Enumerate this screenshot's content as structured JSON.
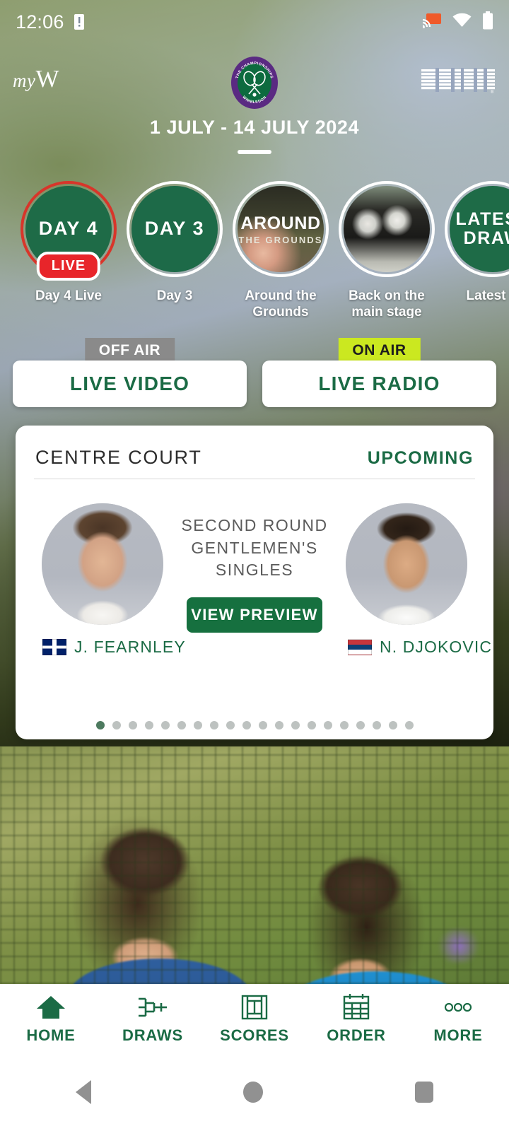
{
  "status_bar": {
    "time": "12:06",
    "icons": [
      "alarm-icon",
      "cast-icon",
      "wifi-icon",
      "battery-icon"
    ]
  },
  "header": {
    "my_wimbledon_label": "myW",
    "my_prefix": "my",
    "w_suffix": "W",
    "crest_label": "THE CHAMPIONSHIPS WIMBLEDON",
    "sponsor": "IBM",
    "dates": "1 JULY - 14 JULY 2024"
  },
  "stories": [
    {
      "ring_text": "DAY 4",
      "label": "Day 4 Live",
      "live": true,
      "live_badge": "LIVE",
      "style": "green"
    },
    {
      "ring_text": "DAY 3",
      "label": "Day 3",
      "live": false,
      "style": "green"
    },
    {
      "ring_text": "AROUND",
      "ring_sub": "THE GROUNDS",
      "label": "Around the Grounds",
      "live": false,
      "style": "photo-grounds"
    },
    {
      "ring_text": "",
      "label": "Back on the main stage",
      "live": false,
      "style": "photo-stage"
    },
    {
      "ring_text": "LATEST DRAW",
      "label": "Latest D",
      "live": false,
      "style": "green"
    }
  ],
  "air_buttons": [
    {
      "badge": "OFF AIR",
      "badge_state": "off",
      "label": "LIVE VIDEO"
    },
    {
      "badge": "ON AIR",
      "badge_state": "on",
      "label": "LIVE RADIO"
    }
  ],
  "match_card": {
    "court": "CENTRE COURT",
    "status": "UPCOMING",
    "round": "SECOND ROUND GENTLEMEN'S SINGLES",
    "preview_button": "VIEW PREVIEW",
    "players": [
      {
        "name": "J. FEARNLEY",
        "country": "GB",
        "flag": "flag-gb-icon"
      },
      {
        "name": "N. DJOKOVIC",
        "country": "RS",
        "flag": "flag-rs-icon"
      }
    ],
    "pagination": {
      "total": 20,
      "active_index": 0
    }
  },
  "bottom_nav": [
    {
      "label": "HOME",
      "icon": "home-icon",
      "active": true
    },
    {
      "label": "DRAWS",
      "icon": "bracket-icon",
      "active": false
    },
    {
      "label": "SCORES",
      "icon": "court-icon",
      "active": false
    },
    {
      "label": "ORDER",
      "icon": "calendar-icon",
      "active": false
    },
    {
      "label": "MORE",
      "icon": "ellipsis-icon",
      "active": false
    }
  ],
  "system_nav": {
    "back": "back-button",
    "home": "home-button",
    "recents": "recents-button"
  },
  "colors": {
    "wimbledon_green": "#1b6b45",
    "wimbledon_purple": "#5a2a82",
    "live_red": "#e8252a",
    "on_air": "#cbe820",
    "off_air": "#8a8a8a"
  }
}
